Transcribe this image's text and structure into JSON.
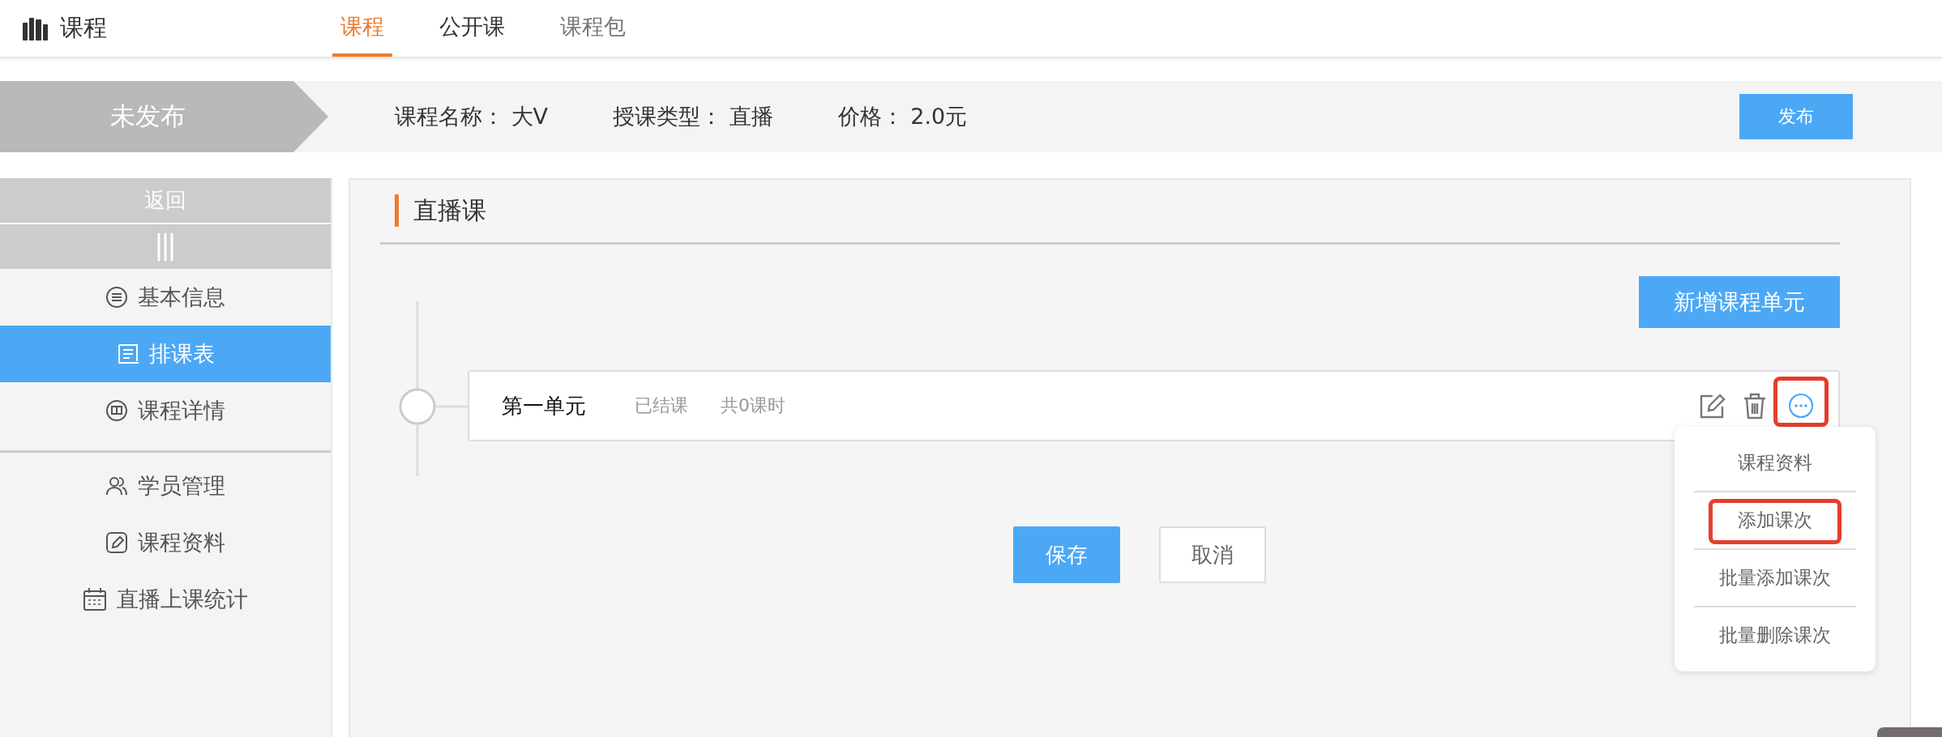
{
  "header": {
    "title": "课程",
    "tabs": [
      {
        "label": "课程",
        "selected": true
      },
      {
        "label": "公开课",
        "selected": false
      },
      {
        "label": "课程包",
        "selected": false
      }
    ]
  },
  "course_bar": {
    "status": "未发布",
    "fields": [
      {
        "label": "课程名称：",
        "value": "大V"
      },
      {
        "label": "授课类型：",
        "value": "直播"
      },
      {
        "label": "价格：",
        "value": "2.0元"
      }
    ],
    "publish_button": "发布"
  },
  "sidebar": {
    "back": "返回",
    "sections": [
      {
        "items": [
          {
            "label": "基本信息",
            "selected": false
          },
          {
            "label": "排课表",
            "selected": true
          },
          {
            "label": "课程详情",
            "selected": false
          }
        ]
      },
      {
        "items": [
          {
            "label": "学员管理",
            "selected": false
          },
          {
            "label": "课程资料",
            "selected": false
          },
          {
            "label": "直播上课统计",
            "selected": false
          }
        ]
      }
    ]
  },
  "main": {
    "title": "直播课",
    "add_unit_button": "新增课程单元",
    "units": [
      {
        "name": "第一单元",
        "status": "已结课",
        "lessons": "共0课时",
        "more_highlighted": true
      }
    ],
    "menu": [
      {
        "label": "课程资料",
        "highlighted": false
      },
      {
        "label": "添加课次",
        "highlighted": true
      },
      {
        "label": "批量添加课次",
        "highlighted": false
      },
      {
        "label": "批量删除课次",
        "highlighted": false
      }
    ],
    "save_button": "保存",
    "cancel_button": "取消"
  }
}
